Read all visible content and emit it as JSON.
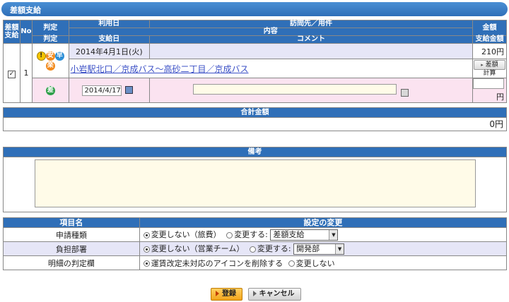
{
  "title": "差額支給",
  "table": {
    "col_sagaku": "差額支給",
    "col_no": "No",
    "col_hantei": "判定",
    "col_riyobi": "利用日",
    "col_homon": "訪問先／用件",
    "col_naiyo": "内容",
    "col_kingaku": "金額",
    "col_hantei2": "判定",
    "col_shikyubi": "支給日",
    "col_comment": "コメント",
    "col_shikyu_kingaku": "支給金額",
    "row": {
      "no": "1",
      "checked": true,
      "date": "2014年4月1日(火)",
      "route": "小岩駅北口／京成バス〜高砂二丁目／京成バス",
      "amount": "210円",
      "calc_button": "差額計算",
      "icons": [
        "warning-icon",
        "an-icon",
        "haya-icon",
        "raku-icon"
      ],
      "icon_labels": {
        "warn": "!",
        "an": "安",
        "haya": "早",
        "raku": "楽",
        "sa": "差"
      },
      "pay_date": "2014/4/17",
      "comment": "",
      "pay_amount": "",
      "yen": "円"
    }
  },
  "total": {
    "header": "合計金額",
    "value": "0円"
  },
  "remarks": {
    "header": "備考",
    "value": ""
  },
  "settings": {
    "col_item": "項目名",
    "col_change": "設定の変更",
    "rows": [
      {
        "label": "申請種類",
        "opt1": "変更しない（旅費）",
        "opt2": "変更する:",
        "select": "差額支給"
      },
      {
        "label": "負担部署",
        "opt1": "変更しない（営業チーム）",
        "opt2": "変更する:",
        "select": "開発部"
      },
      {
        "label": "明細の判定欄",
        "opt1": "運賃改定未対応のアイコンを削除する",
        "opt2": "変更しない"
      }
    ]
  },
  "buttons": {
    "submit": "登録",
    "cancel": "キャンセル"
  },
  "colors": {
    "header_blue": "#2f6fb8",
    "row_lavender": "#e6e6f7",
    "row_pink": "#fbe3f0",
    "link": "#3a4fc6"
  }
}
